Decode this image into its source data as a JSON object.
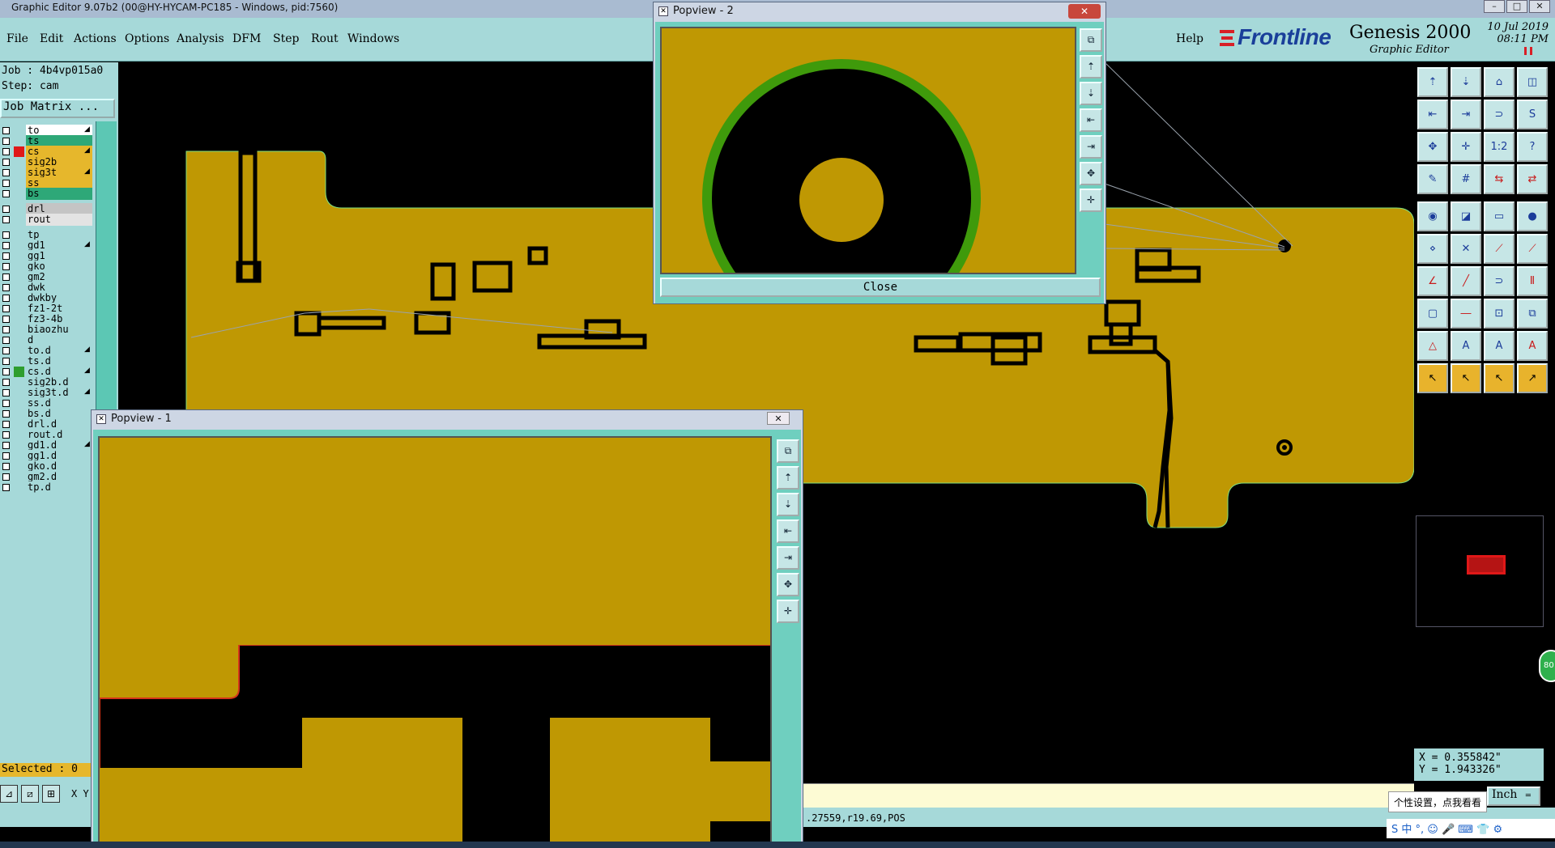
{
  "window": {
    "title": "Graphic Editor 9.07b2 (00@HY-HYCAM-PC185 - Windows, pid:7560)",
    "buttons": [
      "–",
      "□",
      "✕"
    ]
  },
  "menu": {
    "items": [
      "File",
      "Edit",
      "Actions",
      "Options",
      "Analysis",
      "DFM",
      "Step",
      "Rout",
      "Windows"
    ],
    "help": "Help"
  },
  "brand": {
    "logo": "Frontline",
    "product": "Genesis 2000",
    "subtitle": "Graphic Editor",
    "date": "10 Jul 2019",
    "time": "08:11 PM"
  },
  "job": {
    "job_line": "Job : 4b4vp015a0",
    "step_line": "Step: cam",
    "matrix_button": "Job Matrix ..."
  },
  "layers": [
    {
      "name": "to",
      "color": "#ffffff",
      "sw": "",
      "arrow": "◢"
    },
    {
      "name": "ts",
      "color": "#2ea878",
      "sw": "",
      "arrow": ""
    },
    {
      "name": "cs",
      "color": "#e6b72c",
      "sw": "#e01818",
      "arrow": "◢ ▪"
    },
    {
      "name": "sig2b",
      "color": "#e6b72c",
      "sw": "",
      "arrow": ""
    },
    {
      "name": "sig3t",
      "color": "#e6b72c",
      "sw": "",
      "arrow": "◢"
    },
    {
      "name": "ss",
      "color": "#e6b72c",
      "sw": "",
      "arrow": ""
    },
    {
      "name": "bs",
      "color": "#2ea878",
      "sw": "",
      "arrow": ""
    },
    {
      "name": "drl",
      "color": "#c4c4c4",
      "sw": "",
      "arrow": ""
    },
    {
      "name": "rout",
      "color": "#e3e3e3",
      "sw": "",
      "arrow": ""
    },
    {
      "name": "tp",
      "color": "#a6d9d9",
      "sw": "",
      "arrow": ""
    },
    {
      "name": "gd1",
      "color": "#a6d9d9",
      "sw": "",
      "arrow": "◢"
    },
    {
      "name": "gg1",
      "color": "#a6d9d9",
      "sw": "",
      "arrow": ""
    },
    {
      "name": "gko",
      "color": "#a6d9d9",
      "sw": "",
      "arrow": ""
    },
    {
      "name": "gm2",
      "color": "#a6d9d9",
      "sw": "",
      "arrow": ""
    },
    {
      "name": "dwk",
      "color": "#a6d9d9",
      "sw": "",
      "arrow": ""
    },
    {
      "name": "dwkby",
      "color": "#a6d9d9",
      "sw": "",
      "arrow": ""
    },
    {
      "name": "fz1-2t",
      "color": "#a6d9d9",
      "sw": "",
      "arrow": ""
    },
    {
      "name": "fz3-4b",
      "color": "#a6d9d9",
      "sw": "",
      "arrow": ""
    },
    {
      "name": "biaozhu",
      "color": "#a6d9d9",
      "sw": "",
      "arrow": ""
    },
    {
      "name": "d",
      "color": "#a6d9d9",
      "sw": "",
      "arrow": ""
    },
    {
      "name": "to.d",
      "color": "#a6d9d9",
      "sw": "",
      "arrow": "◢"
    },
    {
      "name": "ts.d",
      "color": "#a6d9d9",
      "sw": "",
      "arrow": ""
    },
    {
      "name": "cs.d",
      "color": "#a6d9d9",
      "sw": "#2e9e2e",
      "arrow": "◢"
    },
    {
      "name": "sig2b.d",
      "color": "#a6d9d9",
      "sw": "",
      "arrow": ""
    },
    {
      "name": "sig3t.d",
      "color": "#a6d9d9",
      "sw": "",
      "arrow": "◢"
    },
    {
      "name": "ss.d",
      "color": "#a6d9d9",
      "sw": "",
      "arrow": ""
    },
    {
      "name": "bs.d",
      "color": "#a6d9d9",
      "sw": "",
      "arrow": ""
    },
    {
      "name": "drl.d",
      "color": "#a6d9d9",
      "sw": "",
      "arrow": ""
    },
    {
      "name": "rout.d",
      "color": "#a6d9d9",
      "sw": "",
      "arrow": ""
    },
    {
      "name": "gd1.d",
      "color": "#a6d9d9",
      "sw": "",
      "arrow": "◢"
    },
    {
      "name": "gg1.d",
      "color": "#a6d9d9",
      "sw": "",
      "arrow": ""
    },
    {
      "name": "gko.d",
      "color": "#a6d9d9",
      "sw": "",
      "arrow": ""
    },
    {
      "name": "gm2.d",
      "color": "#a6d9d9",
      "sw": "",
      "arrow": ""
    },
    {
      "name": "tp.d",
      "color": "#a6d9d9",
      "sw": "",
      "arrow": ""
    }
  ],
  "selection": {
    "text": "Selected : 0"
  },
  "bottom_left": {
    "xy_label": "X Y"
  },
  "popview1": {
    "title": "Popview - 1",
    "close_x": "✕"
  },
  "popview2": {
    "title": "Popview - 2",
    "close_x": "✕",
    "close_button": "Close"
  },
  "coords": {
    "x": "X = 0.355842\"",
    "y": "Y = 1.943326\""
  },
  "units": {
    "label": "Inch",
    "arrow": "═"
  },
  "status": {
    "text": ".27559,r19.69,POS"
  },
  "ime": {
    "tip": "个性设置，点我看看",
    "bar": "S 中 °, ☺ 🎤 ⌨ 👕 ⚙"
  },
  "badge": {
    "text": "80"
  },
  "colors": {
    "copper": "#bf9803",
    "background": "#000000",
    "panel": "#a6d9d9",
    "highlight": "#e6b72c",
    "pad_ring": "#3f9a0b"
  }
}
